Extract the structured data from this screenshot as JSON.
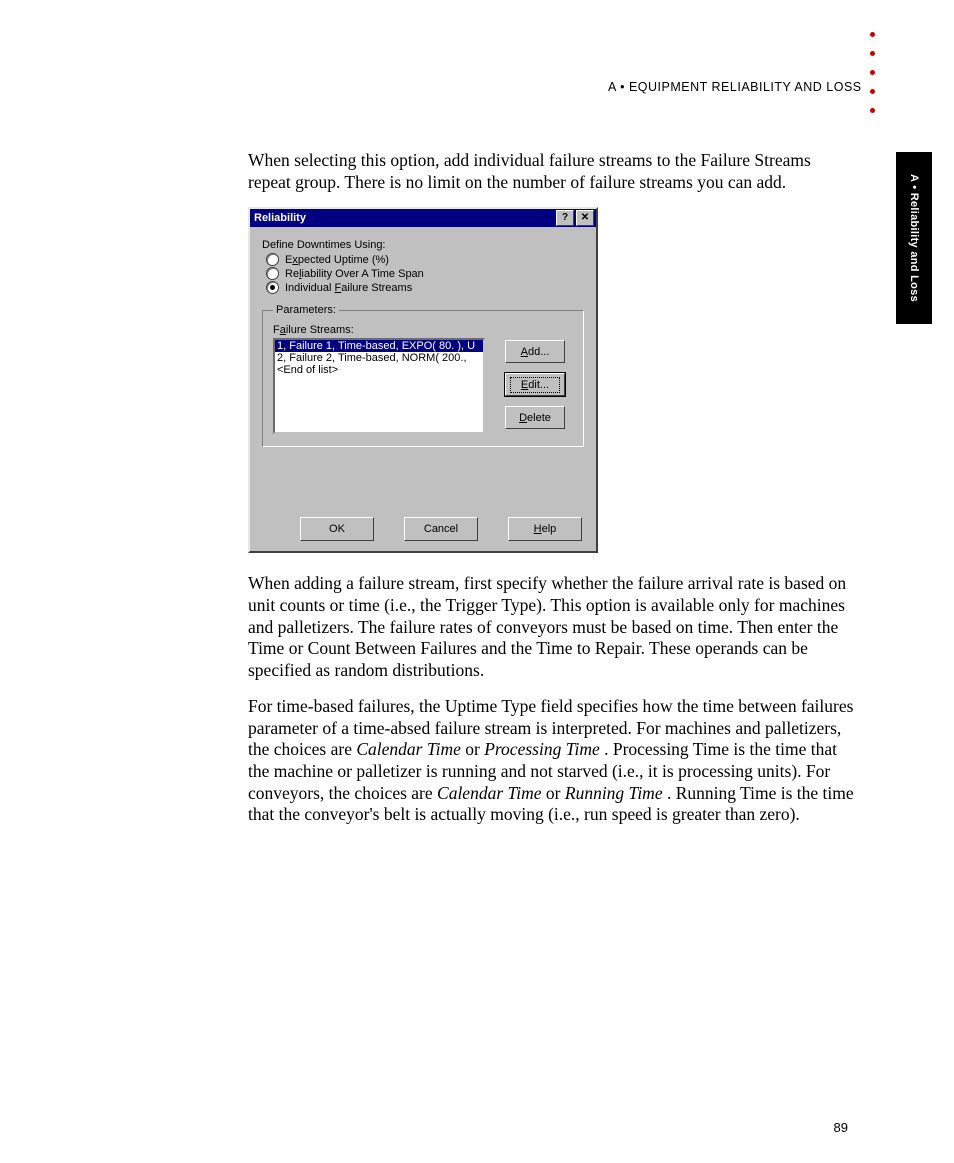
{
  "header": "A • EQUIPMENT RELIABILITY AND LOSS",
  "side_tab": "A • Reliability and Loss",
  "page_number": "89",
  "paragraphs": {
    "p1": "When selecting this option, add individual failure streams to the Failure Streams repeat group. There is no limit on the number of failure streams you can add.",
    "p2_pre": "When adding a failure stream, first specify whether the failure arrival rate is based on unit counts or time (i.e., the Trigger Type). This option is available only for machines and palletizers. The failure rates of conveyors must be based on time. Then enter the Time or Count Between Failures and the Time to Repair. These operands can be specified as random distributions.",
    "p3_a": "For time-based failures, the Uptime Type field specifies how the time between failures parameter of a time-absed failure stream is interpreted. For machines and palletizers, the choices are ",
    "p3_ct": "Calendar Time",
    "p3_or1": " or ",
    "p3_pt": "Processing Time",
    "p3_b": ". Processing Time is the time that the machine or palletizer is running and not starved (i.e., it is processing units). For conveyors, the choices are ",
    "p3_ct2": "Calendar Time",
    "p3_or2": " or ",
    "p3_rt": "Running Time",
    "p3_c": ". Running Time is the time that the conveyor's belt is actually moving (i.e., run speed is greater than zero)."
  },
  "dialog": {
    "title": "Reliability",
    "titlebar": {
      "help": "?",
      "close": "✕"
    },
    "define_label": "Define Downtimes Using:",
    "radios": {
      "r1_pre": "E",
      "r1_ul": "x",
      "r1_post": "pected Uptime (%)",
      "r2_pre": "Re",
      "r2_ul": "l",
      "r2_post": "iability Over A Time Span",
      "r3_pre": "Individual ",
      "r3_ul": "F",
      "r3_post": "ailure Streams"
    },
    "fieldset_legend": "Parameters:",
    "fs_label_pre": "F",
    "fs_label_ul": "a",
    "fs_label_post": "ilure Streams:",
    "list_items": [
      "1, Failure 1, Time-based, EXPO( 80. ), U",
      "2, Failure 2, Time-based, NORM( 200.,",
      "<End of list>"
    ],
    "buttons": {
      "add_ul": "A",
      "add_post": "dd...",
      "edit_ul": "E",
      "edit_post": "dit...",
      "delete_ul": "D",
      "delete_post": "elete",
      "ok": "OK",
      "cancel": "Cancel",
      "help_ul": "H",
      "help_post": "elp"
    }
  }
}
